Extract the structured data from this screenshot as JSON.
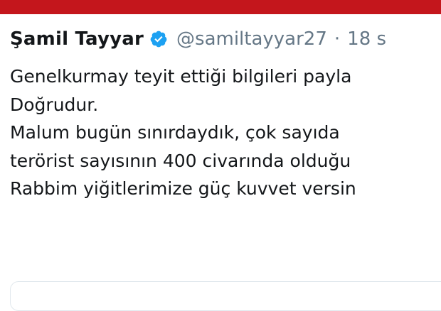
{
  "header_bar": {
    "color": "#c4161c"
  },
  "tweet": {
    "author": {
      "display_name": "Şamil Tayyar",
      "handle": "@samiltayyar27",
      "verified": true,
      "verified_icon": "verified-badge-icon",
      "verified_color": "#1da1f2"
    },
    "separator": "·",
    "time": "18 s",
    "lines": [
      "Genelkurmay teyit ettiği bilgileri payla",
      "Doğrudur.",
      "Malum bugün sınırdaydık, çok sayıda",
      "terörist sayısının 400 civarında olduğu",
      "Rabbim yiğitlerimize güç kuvvet versin"
    ]
  }
}
